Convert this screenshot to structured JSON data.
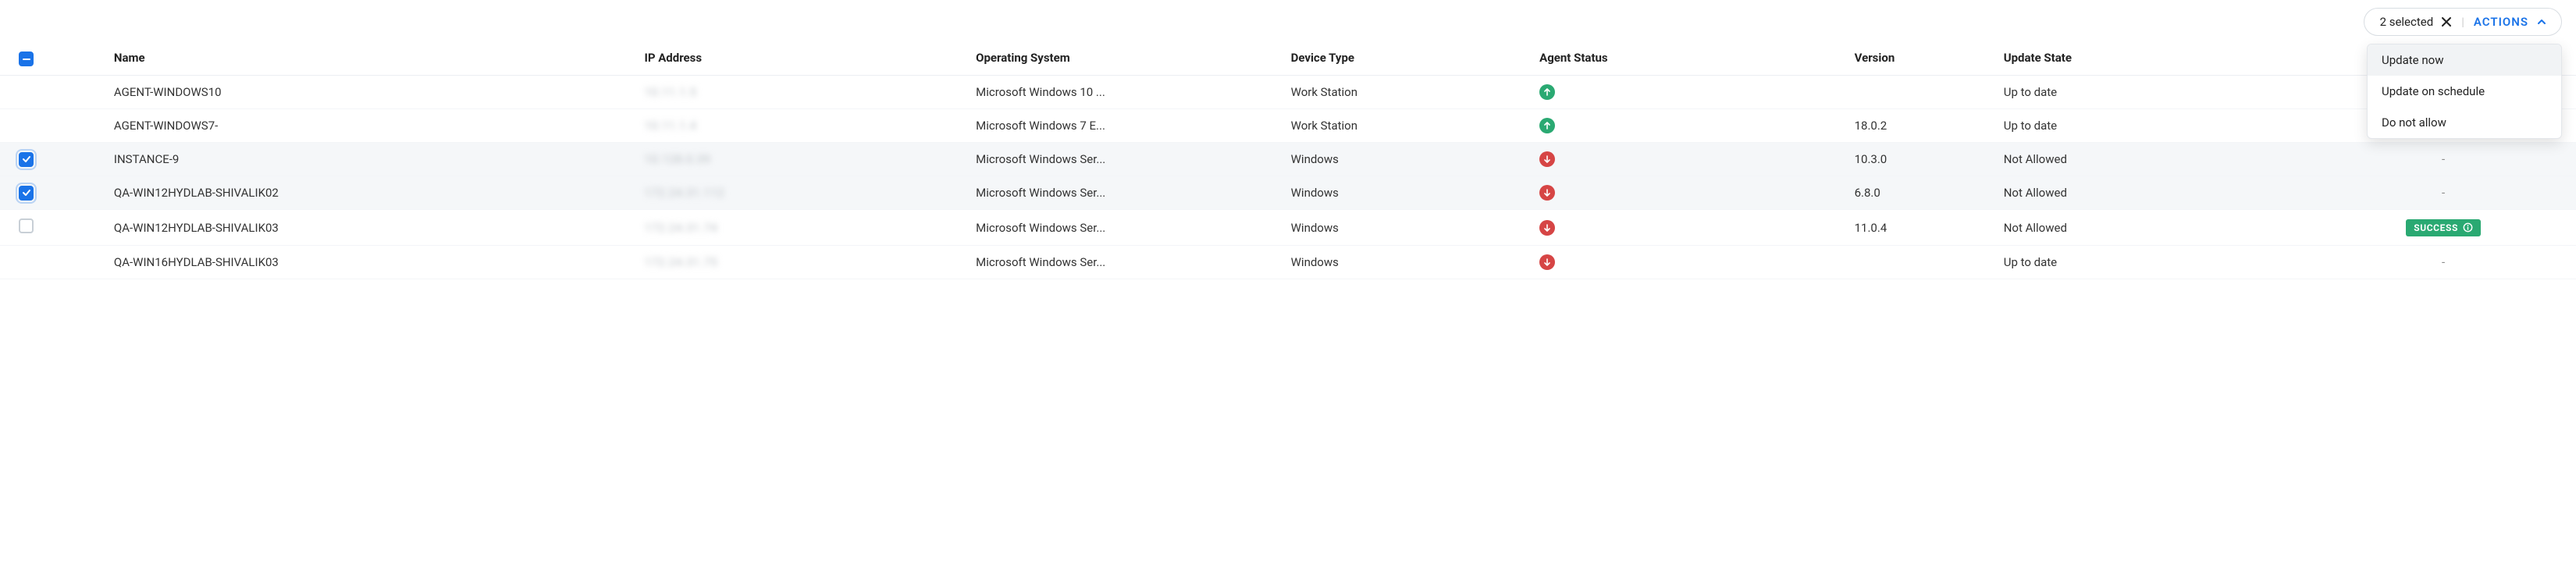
{
  "toolbar": {
    "selected_count_label": "2 selected",
    "actions_label": "ACTIONS"
  },
  "actions_menu": [
    {
      "label": "Update now",
      "highlight": true
    },
    {
      "label": "Update on schedule",
      "highlight": false
    },
    {
      "label": "Do not allow",
      "highlight": false
    }
  ],
  "columns": {
    "check": "",
    "name": "Name",
    "ip": "IP Address",
    "os": "Operating System",
    "device": "Device Type",
    "status": "Agent Status",
    "version": "Version",
    "update": "Update State",
    "last": ""
  },
  "rows": [
    {
      "checkbox": "none",
      "name": "AGENT-WINDOWS10",
      "ip": "10.11.1.5",
      "os": "Microsoft Windows 10 ...",
      "device": "Work Station",
      "status": "up",
      "version": "",
      "update": "Up to date",
      "last_type": "none",
      "selected": false
    },
    {
      "checkbox": "none",
      "name": "AGENT-WINDOWS7-",
      "ip": "10.11.1.4",
      "os": "Microsoft Windows 7 E...",
      "device": "Work Station",
      "status": "up",
      "version": "18.0.2",
      "update": "Up to date",
      "last_type": "none",
      "selected": false
    },
    {
      "checkbox": "checked",
      "name": "INSTANCE-9",
      "ip": "10.128.0.39",
      "os": "Microsoft Windows Ser...",
      "device": "Windows",
      "status": "down",
      "version": "10.3.0",
      "update": "Not Allowed",
      "last_type": "dash",
      "selected": true
    },
    {
      "checkbox": "checked",
      "name": "QA-WIN12HYDLAB-SHIVALIK02",
      "ip": "172.24.31.112",
      "os": "Microsoft Windows Ser...",
      "device": "Windows",
      "status": "down",
      "version": "6.8.0",
      "update": "Not Allowed",
      "last_type": "dash",
      "selected": true
    },
    {
      "checkbox": "unchecked",
      "name": "QA-WIN12HYDLAB-SHIVALIK03",
      "ip": "172.24.31.74",
      "os": "Microsoft Windows Ser...",
      "device": "Windows",
      "status": "down",
      "version": "11.0.4",
      "update": "Not Allowed",
      "last_type": "success",
      "last_label": "SUCCESS",
      "selected": false
    },
    {
      "checkbox": "none",
      "name": "QA-WIN16HYDLAB-SHIVALIK03",
      "ip": "172.24.31.75",
      "os": "Microsoft Windows Ser...",
      "device": "Windows",
      "status": "down",
      "version": "",
      "update": "Up to date",
      "last_type": "dash",
      "selected": false
    }
  ]
}
